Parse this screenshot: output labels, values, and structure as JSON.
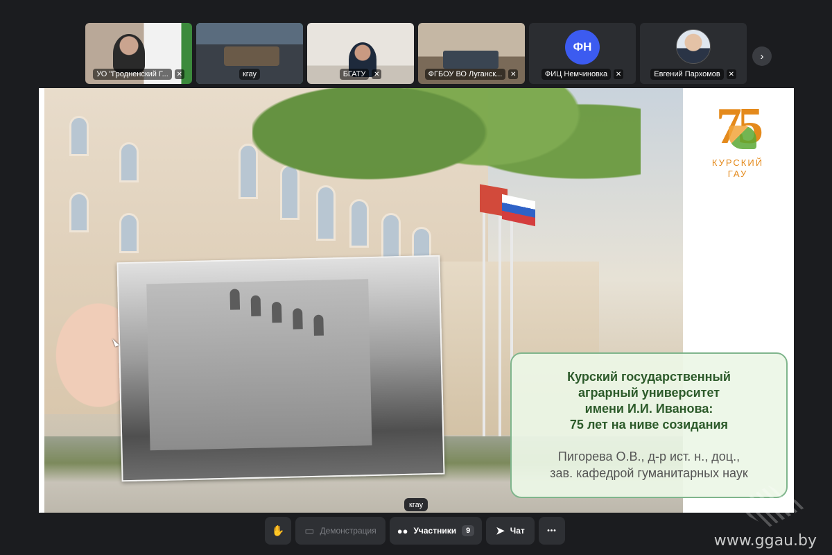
{
  "participants": [
    {
      "name": "УО \"Гродненский Г...",
      "muted": true
    },
    {
      "name": "кгау",
      "muted": false,
      "active": true
    },
    {
      "name": "БГАТУ",
      "muted": true
    },
    {
      "name": "ФГБОУ ВО Луганск...",
      "muted": true
    },
    {
      "name": "ФИЦ Немчиновка",
      "muted": true,
      "initials": "ФН"
    },
    {
      "name": "Евгений Пархомов",
      "muted": true
    }
  ],
  "slide": {
    "logo": {
      "number": "75",
      "caption_line1": "КУРСКИЙ",
      "caption_line2": "ГАУ"
    },
    "title_lines": [
      "Курский государственный",
      "аграрный университет",
      "имени И.И. Иванова:",
      "75 лет на ниве созидания"
    ],
    "author_lines": [
      "Пигорева О.В., д-р ист. н., доц.,",
      "зав. кафедрой гуманитарных наук"
    ]
  },
  "presenter_label": "кгау",
  "toolbar": {
    "demo_label": "Демонстрация",
    "participants_label": "Участники",
    "participants_count": "9",
    "chat_label": "Чат",
    "more_label": "•••"
  },
  "icons": {
    "raise_hand": "✋",
    "screen": "▭",
    "people": "👥",
    "send": "➤",
    "next": "›",
    "mic_off": "🎙"
  },
  "watermark": "www.ggau.by",
  "colors": {
    "active_outline": "#3ddc84",
    "avatar_bg": "#3c5bf0",
    "logo_orange": "#e48a1c",
    "title_green": "#2c5a2a"
  }
}
